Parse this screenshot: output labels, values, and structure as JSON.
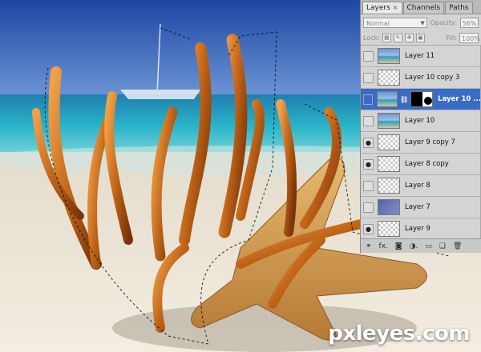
{
  "watermark": "pxleyes.com",
  "panel": {
    "tabs": [
      {
        "label": "Layers",
        "close": "×"
      },
      {
        "label": "Channels"
      },
      {
        "label": "Paths"
      }
    ],
    "blend_mode": "Normal",
    "opacity_label": "Opacity:",
    "opacity_value": "56%",
    "lock_label": "Lock:",
    "fill_label": "Fill:",
    "fill_value": "100%",
    "layers": [
      {
        "name": "Layer 11",
        "visible": false,
        "thumb": "photo",
        "selected": false
      },
      {
        "name": "Layer 10 copy 3",
        "visible": false,
        "thumb": "check",
        "selected": false
      },
      {
        "name": "Layer 10 ...",
        "visible": false,
        "thumb": "photo-mask",
        "selected": true
      },
      {
        "name": "Layer 10",
        "visible": false,
        "thumb": "photo",
        "selected": false
      },
      {
        "name": "Layer 9 copy 7",
        "visible": true,
        "thumb": "check",
        "selected": false
      },
      {
        "name": "Layer 8 copy",
        "visible": true,
        "thumb": "check",
        "selected": false
      },
      {
        "name": "Layer 8",
        "visible": false,
        "thumb": "check",
        "selected": false
      },
      {
        "name": "Layer 7",
        "visible": false,
        "thumb": "blue",
        "selected": false
      },
      {
        "name": "Layer 9",
        "visible": true,
        "thumb": "check",
        "selected": false
      }
    ],
    "bottom_icons": [
      "link-icon",
      "fx-icon",
      "mask-icon",
      "adjustment-icon",
      "group-icon",
      "new-layer-icon",
      "trash-icon"
    ],
    "bottom_glyphs": [
      "⚭",
      "fx.",
      "◙",
      "◑.",
      "▭",
      "❏",
      "🗑"
    ]
  },
  "colors": {
    "selection": "#3a6bc7",
    "panel_bg": "#d4d4d4"
  }
}
